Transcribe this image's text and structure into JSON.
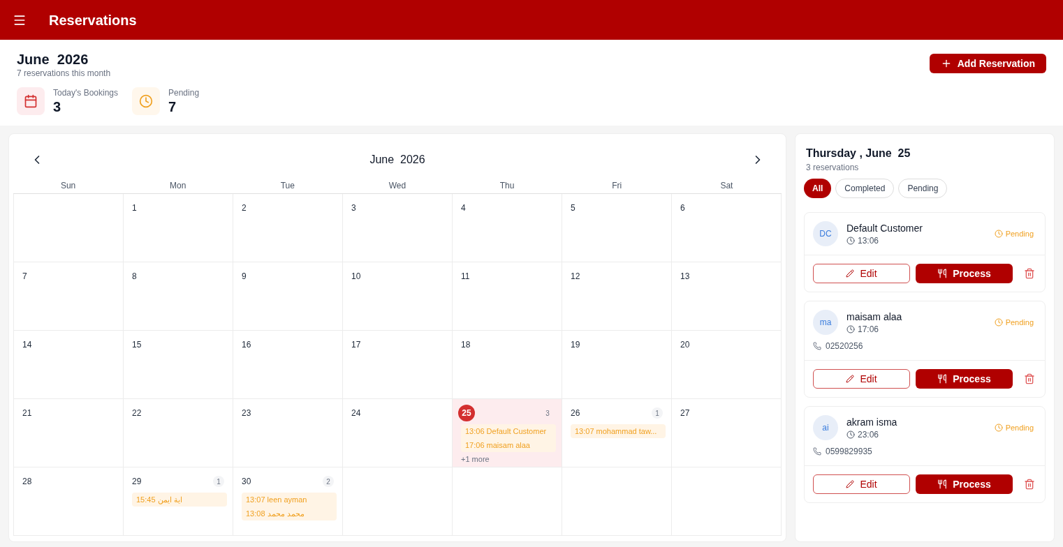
{
  "app_bar": {
    "title": "Reservations"
  },
  "summary": {
    "title": "June  2026",
    "subtitle": "7 reservations this month",
    "add_button": "Add Reservation",
    "stats": [
      {
        "kind": "bookings",
        "label": "Today's Bookings",
        "value": "3"
      },
      {
        "kind": "pending",
        "label": "Pending",
        "value": "7"
      }
    ]
  },
  "calendar": {
    "title": "June  2026",
    "weekdays": [
      "Sun",
      "Mon",
      "Tue",
      "Wed",
      "Thu",
      "Fri",
      "Sat"
    ],
    "weeks": [
      [
        {
          "kind": "empty"
        },
        {
          "kind": "day",
          "day": "1",
          "selected": false
        },
        {
          "kind": "day",
          "day": "2",
          "selected": false
        },
        {
          "kind": "day",
          "day": "3",
          "selected": false
        },
        {
          "kind": "day",
          "day": "4",
          "selected": false
        },
        {
          "kind": "day",
          "day": "5",
          "selected": false
        },
        {
          "kind": "day",
          "day": "6",
          "selected": false
        }
      ],
      [
        {
          "kind": "day",
          "day": "7",
          "selected": false
        },
        {
          "kind": "day",
          "day": "8",
          "selected": false
        },
        {
          "kind": "day",
          "day": "9",
          "selected": false
        },
        {
          "kind": "day",
          "day": "10",
          "selected": false
        },
        {
          "kind": "day",
          "day": "11",
          "selected": false
        },
        {
          "kind": "day",
          "day": "12",
          "selected": false
        },
        {
          "kind": "day",
          "day": "13",
          "selected": false
        }
      ],
      [
        {
          "kind": "day",
          "day": "14",
          "selected": false
        },
        {
          "kind": "day",
          "day": "15",
          "selected": false
        },
        {
          "kind": "day",
          "day": "16",
          "selected": false
        },
        {
          "kind": "day",
          "day": "17",
          "selected": false
        },
        {
          "kind": "day",
          "day": "18",
          "selected": false
        },
        {
          "kind": "day",
          "day": "19",
          "selected": false
        },
        {
          "kind": "day",
          "day": "20",
          "selected": false
        }
      ],
      [
        {
          "kind": "day",
          "day": "21",
          "selected": false
        },
        {
          "kind": "day",
          "day": "22",
          "selected": false
        },
        {
          "kind": "day",
          "day": "23",
          "selected": false
        },
        {
          "kind": "day",
          "day": "24",
          "selected": false
        },
        {
          "kind": "day",
          "day": "25",
          "selected": true,
          "count": "3",
          "events": [
            "13:06 Default Customer",
            "17:06 maisam alaa"
          ],
          "more": "+1 more"
        },
        {
          "kind": "day",
          "day": "26",
          "selected": false,
          "count": "1",
          "events": [
            "13:07 mohammad taw..."
          ]
        },
        {
          "kind": "day",
          "day": "27",
          "selected": false
        }
      ],
      [
        {
          "kind": "day",
          "day": "28",
          "selected": false
        },
        {
          "kind": "day",
          "day": "29",
          "selected": false,
          "count": "1",
          "events": [
            "15:45 اية ايمن"
          ]
        },
        {
          "kind": "day",
          "day": "30",
          "selected": false,
          "count": "2",
          "events": [
            "13:07 leen ayman",
            "13:08 محمد محمد"
          ]
        },
        {
          "kind": "empty"
        },
        {
          "kind": "empty"
        },
        {
          "kind": "empty"
        },
        {
          "kind": "empty"
        }
      ]
    ]
  },
  "day_panel": {
    "title": "Thursday , June  25",
    "subtitle": "3 reservations",
    "filters": [
      {
        "label": "All",
        "selected": true
      },
      {
        "label": "Completed",
        "selected": false
      },
      {
        "label": "Pending",
        "selected": false
      }
    ],
    "reservations": [
      {
        "initials": "DC",
        "name": "Default Customer",
        "time": "13:06",
        "status": "Pending",
        "edit": "Edit",
        "process": "Process"
      },
      {
        "initials": "ma",
        "name": "maisam alaa",
        "time": "17:06",
        "status": "Pending",
        "phone": "02520256",
        "edit": "Edit",
        "process": "Process"
      },
      {
        "initials": "ai",
        "name": "akram isma",
        "time": "23:06",
        "status": "Pending",
        "phone": "0599829935",
        "edit": "Edit",
        "process": "Process"
      }
    ]
  }
}
